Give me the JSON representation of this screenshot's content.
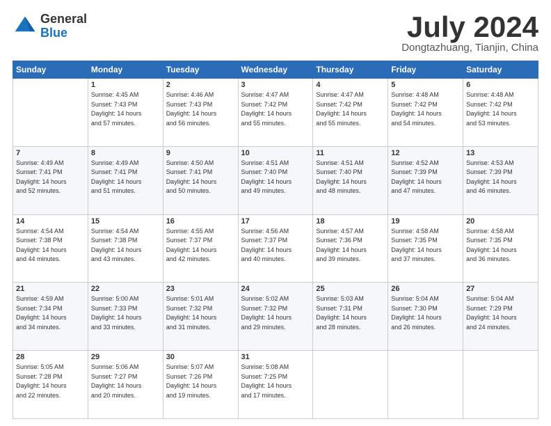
{
  "header": {
    "logo_general": "General",
    "logo_blue": "Blue",
    "month_title": "July 2024",
    "location": "Dongtazhuang, Tianjin, China"
  },
  "weekdays": [
    "Sunday",
    "Monday",
    "Tuesday",
    "Wednesday",
    "Thursday",
    "Friday",
    "Saturday"
  ],
  "weeks": [
    [
      {
        "day": "",
        "sunrise": "",
        "sunset": "",
        "daylight": ""
      },
      {
        "day": "1",
        "sunrise": "Sunrise: 4:45 AM",
        "sunset": "Sunset: 7:43 PM",
        "daylight": "Daylight: 14 hours and 57 minutes."
      },
      {
        "day": "2",
        "sunrise": "Sunrise: 4:46 AM",
        "sunset": "Sunset: 7:43 PM",
        "daylight": "Daylight: 14 hours and 56 minutes."
      },
      {
        "day": "3",
        "sunrise": "Sunrise: 4:47 AM",
        "sunset": "Sunset: 7:42 PM",
        "daylight": "Daylight: 14 hours and 55 minutes."
      },
      {
        "day": "4",
        "sunrise": "Sunrise: 4:47 AM",
        "sunset": "Sunset: 7:42 PM",
        "daylight": "Daylight: 14 hours and 55 minutes."
      },
      {
        "day": "5",
        "sunrise": "Sunrise: 4:48 AM",
        "sunset": "Sunset: 7:42 PM",
        "daylight": "Daylight: 14 hours and 54 minutes."
      },
      {
        "day": "6",
        "sunrise": "Sunrise: 4:48 AM",
        "sunset": "Sunset: 7:42 PM",
        "daylight": "Daylight: 14 hours and 53 minutes."
      }
    ],
    [
      {
        "day": "7",
        "sunrise": "Sunrise: 4:49 AM",
        "sunset": "Sunset: 7:41 PM",
        "daylight": "Daylight: 14 hours and 52 minutes."
      },
      {
        "day": "8",
        "sunrise": "Sunrise: 4:49 AM",
        "sunset": "Sunset: 7:41 PM",
        "daylight": "Daylight: 14 hours and 51 minutes."
      },
      {
        "day": "9",
        "sunrise": "Sunrise: 4:50 AM",
        "sunset": "Sunset: 7:41 PM",
        "daylight": "Daylight: 14 hours and 50 minutes."
      },
      {
        "day": "10",
        "sunrise": "Sunrise: 4:51 AM",
        "sunset": "Sunset: 7:40 PM",
        "daylight": "Daylight: 14 hours and 49 minutes."
      },
      {
        "day": "11",
        "sunrise": "Sunrise: 4:51 AM",
        "sunset": "Sunset: 7:40 PM",
        "daylight": "Daylight: 14 hours and 48 minutes."
      },
      {
        "day": "12",
        "sunrise": "Sunrise: 4:52 AM",
        "sunset": "Sunset: 7:39 PM",
        "daylight": "Daylight: 14 hours and 47 minutes."
      },
      {
        "day": "13",
        "sunrise": "Sunrise: 4:53 AM",
        "sunset": "Sunset: 7:39 PM",
        "daylight": "Daylight: 14 hours and 46 minutes."
      }
    ],
    [
      {
        "day": "14",
        "sunrise": "Sunrise: 4:54 AM",
        "sunset": "Sunset: 7:38 PM",
        "daylight": "Daylight: 14 hours and 44 minutes."
      },
      {
        "day": "15",
        "sunrise": "Sunrise: 4:54 AM",
        "sunset": "Sunset: 7:38 PM",
        "daylight": "Daylight: 14 hours and 43 minutes."
      },
      {
        "day": "16",
        "sunrise": "Sunrise: 4:55 AM",
        "sunset": "Sunset: 7:37 PM",
        "daylight": "Daylight: 14 hours and 42 minutes."
      },
      {
        "day": "17",
        "sunrise": "Sunrise: 4:56 AM",
        "sunset": "Sunset: 7:37 PM",
        "daylight": "Daylight: 14 hours and 40 minutes."
      },
      {
        "day": "18",
        "sunrise": "Sunrise: 4:57 AM",
        "sunset": "Sunset: 7:36 PM",
        "daylight": "Daylight: 14 hours and 39 minutes."
      },
      {
        "day": "19",
        "sunrise": "Sunrise: 4:58 AM",
        "sunset": "Sunset: 7:35 PM",
        "daylight": "Daylight: 14 hours and 37 minutes."
      },
      {
        "day": "20",
        "sunrise": "Sunrise: 4:58 AM",
        "sunset": "Sunset: 7:35 PM",
        "daylight": "Daylight: 14 hours and 36 minutes."
      }
    ],
    [
      {
        "day": "21",
        "sunrise": "Sunrise: 4:59 AM",
        "sunset": "Sunset: 7:34 PM",
        "daylight": "Daylight: 14 hours and 34 minutes."
      },
      {
        "day": "22",
        "sunrise": "Sunrise: 5:00 AM",
        "sunset": "Sunset: 7:33 PM",
        "daylight": "Daylight: 14 hours and 33 minutes."
      },
      {
        "day": "23",
        "sunrise": "Sunrise: 5:01 AM",
        "sunset": "Sunset: 7:32 PM",
        "daylight": "Daylight: 14 hours and 31 minutes."
      },
      {
        "day": "24",
        "sunrise": "Sunrise: 5:02 AM",
        "sunset": "Sunset: 7:32 PM",
        "daylight": "Daylight: 14 hours and 29 minutes."
      },
      {
        "day": "25",
        "sunrise": "Sunrise: 5:03 AM",
        "sunset": "Sunset: 7:31 PM",
        "daylight": "Daylight: 14 hours and 28 minutes."
      },
      {
        "day": "26",
        "sunrise": "Sunrise: 5:04 AM",
        "sunset": "Sunset: 7:30 PM",
        "daylight": "Daylight: 14 hours and 26 minutes."
      },
      {
        "day": "27",
        "sunrise": "Sunrise: 5:04 AM",
        "sunset": "Sunset: 7:29 PM",
        "daylight": "Daylight: 14 hours and 24 minutes."
      }
    ],
    [
      {
        "day": "28",
        "sunrise": "Sunrise: 5:05 AM",
        "sunset": "Sunset: 7:28 PM",
        "daylight": "Daylight: 14 hours and 22 minutes."
      },
      {
        "day": "29",
        "sunrise": "Sunrise: 5:06 AM",
        "sunset": "Sunset: 7:27 PM",
        "daylight": "Daylight: 14 hours and 20 minutes."
      },
      {
        "day": "30",
        "sunrise": "Sunrise: 5:07 AM",
        "sunset": "Sunset: 7:26 PM",
        "daylight": "Daylight: 14 hours and 19 minutes."
      },
      {
        "day": "31",
        "sunrise": "Sunrise: 5:08 AM",
        "sunset": "Sunset: 7:25 PM",
        "daylight": "Daylight: 14 hours and 17 minutes."
      },
      {
        "day": "",
        "sunrise": "",
        "sunset": "",
        "daylight": ""
      },
      {
        "day": "",
        "sunrise": "",
        "sunset": "",
        "daylight": ""
      },
      {
        "day": "",
        "sunrise": "",
        "sunset": "",
        "daylight": ""
      }
    ]
  ]
}
